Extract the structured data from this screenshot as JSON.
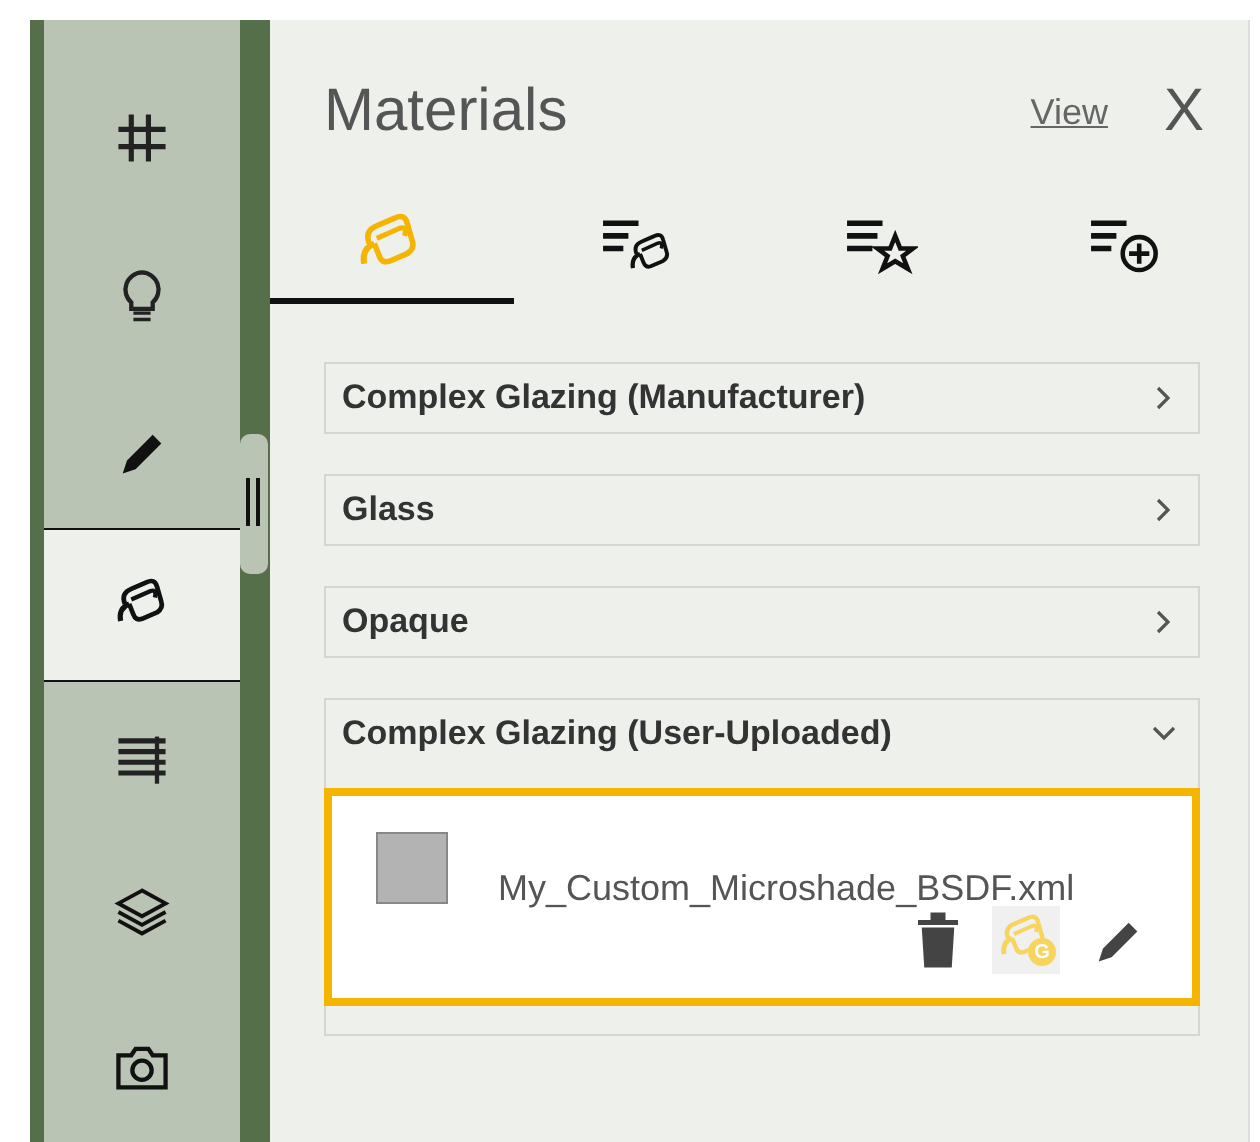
{
  "sidebar": [
    {
      "kind": "grid",
      "selected": false
    },
    {
      "kind": "bulb",
      "selected": false
    },
    {
      "kind": "pencil",
      "selected": false
    },
    {
      "kind": "bucket",
      "selected": true
    },
    {
      "kind": "lines",
      "selected": false
    },
    {
      "kind": "layers",
      "selected": false
    },
    {
      "kind": "camera",
      "selected": false
    }
  ],
  "panel": {
    "title": "Materials",
    "view_link": "View",
    "close": "X"
  },
  "tabs": [
    {
      "kind": "bucket",
      "selected": true
    },
    {
      "kind": "list-bucket",
      "selected": false
    },
    {
      "kind": "list-star",
      "selected": false
    },
    {
      "kind": "list-add",
      "selected": false
    }
  ],
  "categories": [
    {
      "label": "Complex Glazing (Manufacturer)",
      "expanded": false
    },
    {
      "label": "Glass",
      "expanded": false
    },
    {
      "label": "Opaque",
      "expanded": false
    },
    {
      "label": "Complex Glazing (User-Uploaded)",
      "expanded": true,
      "items": [
        {
          "name": "My_Custom_Microshade_BSDF.xml",
          "selected": true,
          "color": "#b3b3b3",
          "apply_badge": "G"
        }
      ]
    }
  ]
}
